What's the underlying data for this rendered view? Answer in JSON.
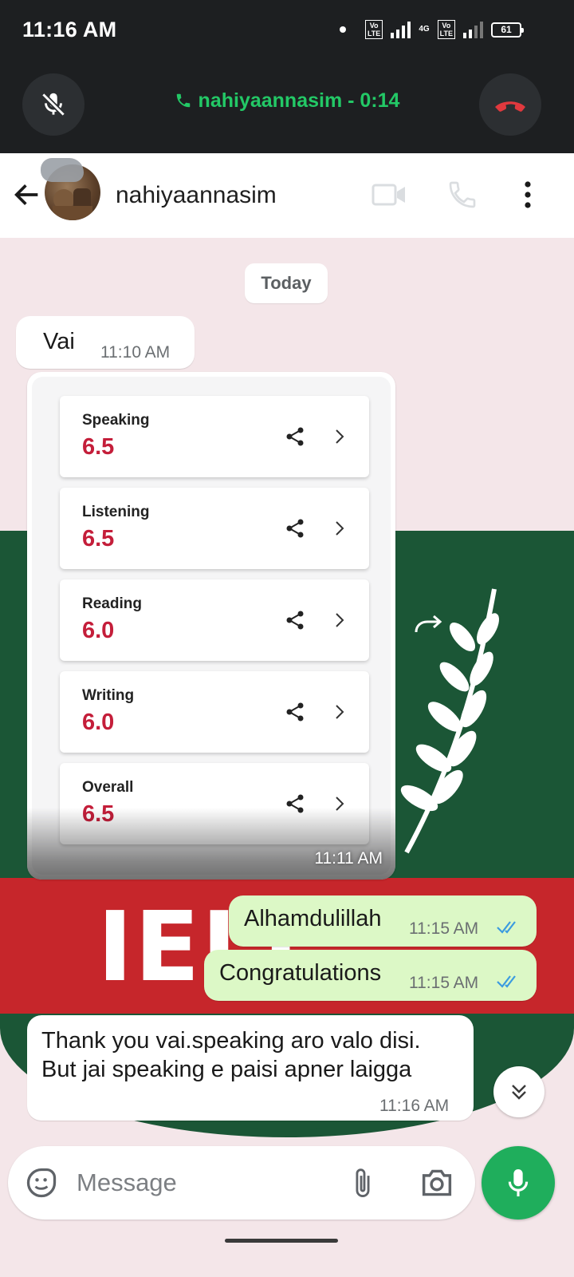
{
  "status_bar": {
    "time": "11:16 AM",
    "network_label": "4G",
    "volte_label": "Vo LTE",
    "battery": "61"
  },
  "call_bar": {
    "caller_and_duration": "nahiyaannasim - 0:14",
    "mute_icon": "mic-off-icon",
    "end_icon": "call-end-icon",
    "accent_color": "#23c866",
    "end_color": "#e0393e"
  },
  "chat_header": {
    "contact_name": "nahiyaannasim"
  },
  "conversation": {
    "date_divider": "Today",
    "messages": [
      {
        "direction": "incoming",
        "text": "Vai",
        "time": "11:10 AM"
      },
      {
        "direction": "incoming",
        "type": "image",
        "time": "11:11 AM",
        "scores": [
          {
            "label": "Speaking",
            "value": "6.5"
          },
          {
            "label": "Listening",
            "value": "6.5"
          },
          {
            "label": "Reading",
            "value": "6.0"
          },
          {
            "label": "Writing",
            "value": "6.0"
          },
          {
            "label": "Overall",
            "value": "6.5"
          }
        ]
      },
      {
        "direction": "outgoing",
        "text": "Alhamdulillah",
        "time": "11:15 AM",
        "status": "read"
      },
      {
        "direction": "outgoing",
        "text": "Congratulations",
        "time": "11:15 AM",
        "status": "read"
      },
      {
        "direction": "incoming",
        "text_line1": "Thank you vai.speaking aro valo disi.",
        "text_line2": "But jai speaking e paisi apner laigga",
        "time": "11:16 AM"
      }
    ]
  },
  "wallpaper": {
    "text": "IELT"
  },
  "composer": {
    "placeholder": "Message"
  },
  "colors": {
    "outgoing_bubble": "#dcf8c6",
    "send_button": "#1fae5c",
    "score_red": "#c41e3a",
    "read_tick": "#3b9be0"
  }
}
